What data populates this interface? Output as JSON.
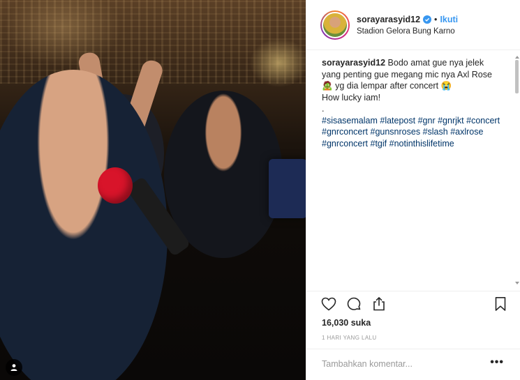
{
  "post": {
    "username": "sorayarasyid12",
    "follow_label": "Ikuti",
    "dot": "•",
    "location": "Stadion Gelora Bung Karno",
    "caption": {
      "username": "sorayarasyid12",
      "text_1": "Bodo amat gue nya jelek yang penting gue megang mic nya Axl Rose",
      "emoji_1": "🧟",
      "text_2": "yg dia lempar after concert",
      "emoji_2": "😭",
      "line_2": "How lucky iam!",
      "line_3": ".",
      "hashtags": [
        "#sisasemalam",
        "#latepost",
        "#gnr",
        "#gnrjkt",
        "#concert",
        "#gnrconcert",
        "#gunsnroses",
        "#slash",
        "#axlrose",
        "#gnrconcert",
        "#tgif",
        "#notinthislifetime"
      ]
    },
    "likes": "16,030 suka",
    "time_ago": "1 HARI YANG LALU",
    "comment_placeholder": "Tambahkan komentar...",
    "more_label": "•••"
  },
  "icons": {
    "verified": "verified-badge-icon",
    "like": "heart-icon",
    "comment": "comment-icon",
    "share": "share-icon",
    "save": "bookmark-icon",
    "user_tag": "user-tag-icon"
  },
  "colors": {
    "link": "#3897f0",
    "hashtag": "#003569",
    "muted": "#999999",
    "text": "#262626"
  }
}
